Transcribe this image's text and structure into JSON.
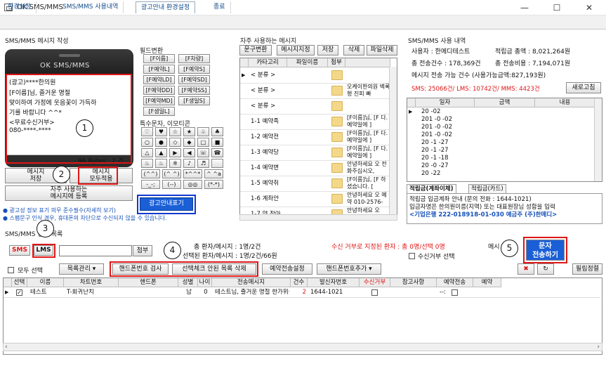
{
  "window": {
    "title": "OK SMS/MMS",
    "minimize": "—",
    "maximize": "☐",
    "close": "✕"
  },
  "menu": {
    "tabs": [
      "환경설정",
      "SMS/MMS 사용내역",
      "광고안내 환경설정",
      "종료"
    ]
  },
  "compose": {
    "title": "SMS/MMS 메시지 작성",
    "phone_name": "OK SMS/MMS",
    "message_lines": [
      "(광고)****한의원",
      "[F이름]님, 즐거운 명절",
      "맞이하여 가정에 웃음꽃이 가득하",
      "기를 바랍니다 ^^*",
      "<무료수신거부>",
      "080-****-****"
    ],
    "bytes": "96 Bytes",
    "count": "2 건",
    "btn_save": "메시지\n저장",
    "btn_all": "메시지\n모두적용",
    "btn_register": "자주 사용하는\n메시지에 등록",
    "notice1": "● 광고성 정보 표기 의무 준수필수(자세히 보기)",
    "notice2": "● 스팸문구 인식 경우, 휴대폰의 차단으로 수신되지 않을 수 있습니다.",
    "btn_ad": "광고안내표기"
  },
  "field_convert": {
    "title": "필드변환",
    "buttons": [
      "[F이름]",
      "[F차량]",
      "[F예약L]",
      "[F예약S]",
      "[F예약LD]",
      "[F예약SD]",
      "[F예약DD]",
      "[F예약SS]",
      "[F예약MD]",
      "[F생일S]",
      "[F생일L]"
    ],
    "emoticon_title": "특수문자, 이모티콘",
    "symbols": [
      "♡",
      "♥",
      "☆",
      "★",
      "♧",
      "♣",
      "○",
      "●",
      "◇",
      "◆",
      "□",
      "■",
      "△",
      "▲",
      "▶",
      "◀",
      "☏",
      "☎",
      "♨",
      "♨",
      "※",
      "♪",
      "♬",
      "",
      "(^^)",
      "(^ ^)",
      "*^^*",
      "^ ^a",
      "-_-;",
      "(--)",
      "◎◎",
      "(*-*)"
    ]
  },
  "frequent": {
    "title": "자주 사용하는 메시지",
    "buttons": [
      "문구변환",
      "메시지지정",
      "저장",
      "삭제",
      "파일삭제"
    ],
    "headers": [
      "카타고리",
      "파일이름",
      "첨부"
    ],
    "rows": [
      {
        "cat": "< 분류 >",
        "msg": ""
      },
      {
        "cat": "< 분류 >",
        "msg": "오케이한의원 벽록형 진피 빠"
      },
      {
        "cat": "< 분류 >",
        "msg": ""
      },
      {
        "cat": "1-1 예약족",
        "msg": "[F이름]님, [F 다. 예약일에 ]"
      },
      {
        "cat": "1-2 예약전",
        "msg": "[F이름]님, [F 다. 예약일에 ]"
      },
      {
        "cat": "1-3 예약당",
        "msg": "[F이름]님, [F 다. 예약일에 ]"
      },
      {
        "cat": "1-4 예약변",
        "msg": "안녕하세요 오 전화주십시오,"
      },
      {
        "cat": "1-5 예약취",
        "msg": "[F이름]님, [F 하셨습니다. ["
      },
      {
        "cat": "1-6 계좌안",
        "msg": "안녕하세요 오 예약 010-2576-"
      },
      {
        "cat": "1-7 약 찾아",
        "msg": "안녕하세요 오"
      }
    ]
  },
  "usage": {
    "title": "SMS/MMS 사용 내역",
    "user_label": "사용자 :",
    "user": "한메디테스트",
    "total_label": "적립금 총액 :",
    "total": "8,021,264원",
    "sent_label": "총 전송건수 :",
    "sent": "178,369건",
    "cost_label": "총 전송비용 :",
    "cost": "7,194,071원",
    "avail": "메시지 전송 가능 건수 (사용가능금액:827,193원)",
    "counts": "SMS: 25066건/ LMS: 10742건/ MMS: 4423건",
    "refresh": "새로고침",
    "headers": [
      "일자",
      "금액",
      "내용"
    ],
    "rows": [
      "20 -02",
      "201 -0 -02",
      "201 -0 -02",
      "201 -0 -02",
      "20 -1 -27",
      "20 -1 -27",
      "20 -1 -18",
      "20 -0 -27",
      "20 -22"
    ],
    "tab1": "적립금(계좌이체)",
    "tab2": "적립금(카드)",
    "info1": "적립금 입금계좌 안내 (문의 전화 : 1644-1021)",
    "info2": "입금자명은 한의원이름(지역) 또는 대표원장님 성함을 입력",
    "info3": "<기업은행 222-018918-01-030 예금주 (주)한메디>"
  },
  "send": {
    "title": "SMS/MMS 전송 목록",
    "sms": "SMS",
    "lms": "LMS",
    "attach": "첨부",
    "total": "총 환자/메시지 : 1명/2건",
    "selected": "선택된 환자/메시지 : 1명/2건/66원",
    "refused": "수신 거부로 지정된 환자 : 총 0명/선택 0명",
    "refuse_select": "수신거부 선택",
    "msg_label": "메시",
    "send_btn": "문자\n전송하기",
    "select_all": "모두 선택",
    "btn_list": "목록관리",
    "btn_check": "핸드폰번호 검사",
    "btn_delete": "선택체크 안된 목록 삭제",
    "btn_reserve": "예약전송설정",
    "btn_add": "핸드폰번호추가",
    "btn_sort": "필림정렬",
    "headers": [
      "선택",
      "이름",
      "차트번호",
      "핸드폰",
      "성별",
      "나이",
      "전송메시지",
      "건수",
      "발신자번호",
      "수신거부",
      "참고사항",
      "예약전송",
      "예약"
    ],
    "row": {
      "name": "테스트",
      "chart": "T-회귀난치",
      "phone": "",
      "gender": "남",
      "age": "0",
      "msg": "테스트님, 즐거운 명절 한가위를",
      "count": "2",
      "sender": "1644-1021",
      "note": "",
      "reserve": "--:"
    }
  },
  "annotations": [
    "1",
    "2",
    "3",
    "4",
    "5"
  ],
  "colors": {
    "red": "#e01515",
    "blue": "#1238d0",
    "link": "#1550b8"
  }
}
